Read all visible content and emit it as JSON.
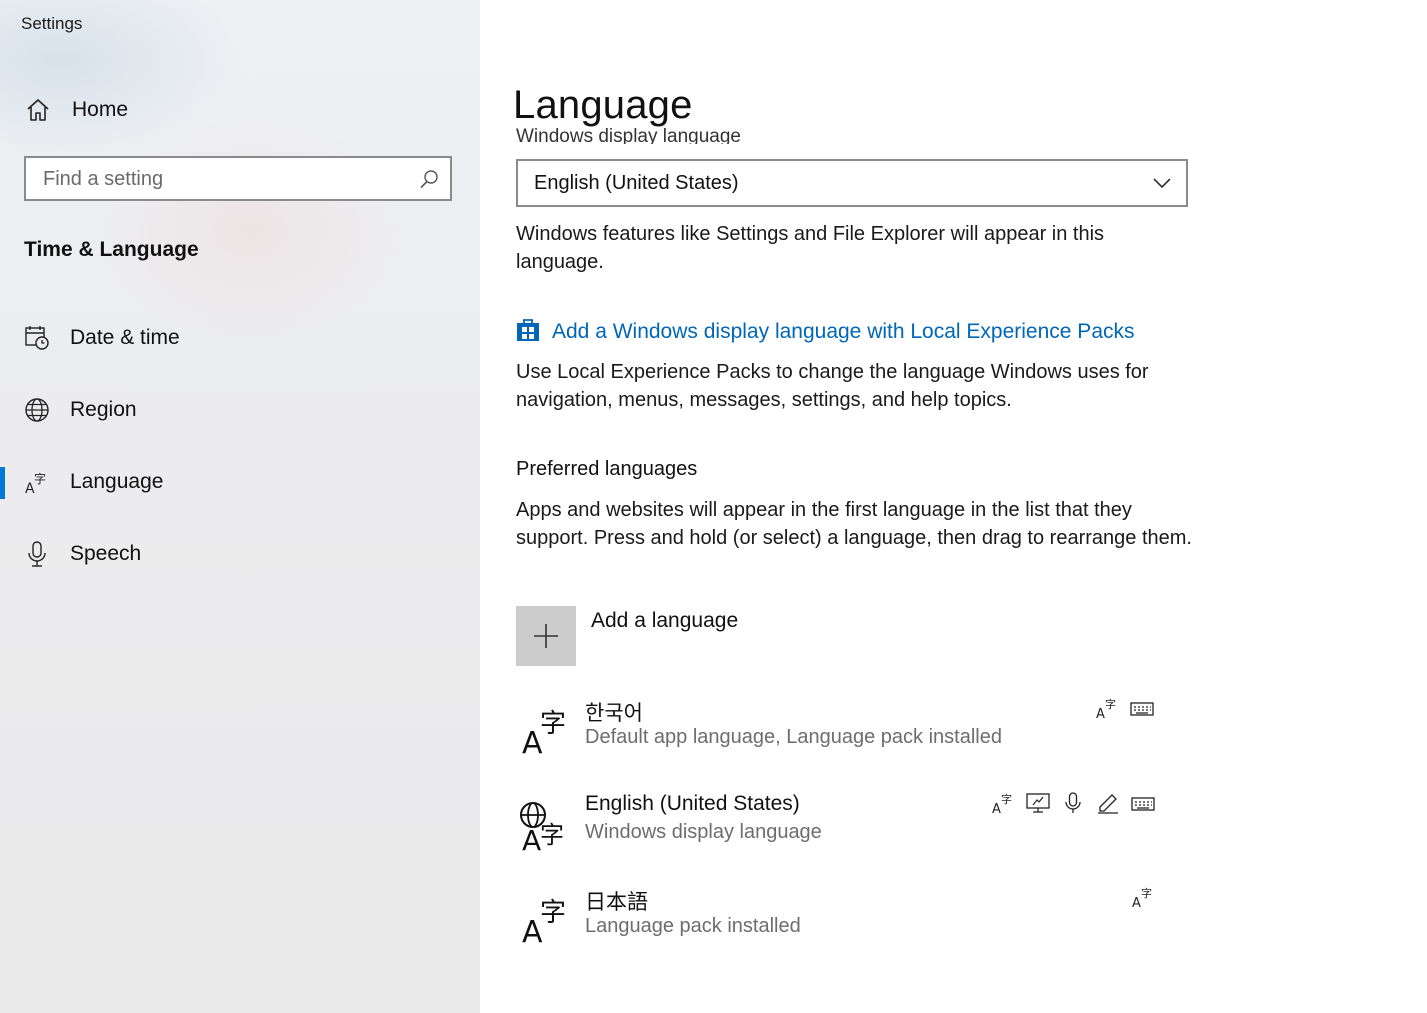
{
  "app": {
    "title": "Settings"
  },
  "sidebar": {
    "home_label": "Home",
    "search": {
      "placeholder": "Find a setting",
      "value": ""
    },
    "section_title": "Time & Language",
    "items": [
      {
        "label": "Date & time",
        "icon": "calendar-clock-icon",
        "selected": false
      },
      {
        "label": "Region",
        "icon": "globe-icon",
        "selected": false
      },
      {
        "label": "Language",
        "icon": "language-icon",
        "selected": true
      },
      {
        "label": "Speech",
        "icon": "microphone-icon",
        "selected": false
      }
    ]
  },
  "main": {
    "title": "Language",
    "clipped_heading": "Windows display language",
    "display_language": {
      "selected": "English (United States)"
    },
    "display_language_desc": "Windows features like Settings and File Explorer will appear in this language.",
    "lxp_link": "Add a Windows display language with Local Experience Packs",
    "lxp_desc": "Use Local Experience Packs to change the language Windows uses for navigation, menus, messages, settings, and help topics.",
    "preferred_heading": "Preferred languages",
    "preferred_desc": "Apps and websites will appear in the first language in the list that they support. Press and hold (or select) a language, then drag to rearrange them.",
    "add_language_label": "Add a language",
    "languages": [
      {
        "name": "한국어",
        "status": "Default app language, Language pack installed",
        "icon": "language-icon",
        "features": [
          "language-pack-icon",
          "keyboard-icon"
        ]
      },
      {
        "name": "English (United States)",
        "status": "Windows display language",
        "icon": "display-language-icon",
        "features": [
          "language-pack-icon",
          "text-to-speech-icon",
          "speech-icon",
          "handwriting-icon",
          "keyboard-icon"
        ]
      },
      {
        "name": "日本語",
        "status": "Language pack installed",
        "icon": "language-icon",
        "features": [
          "language-pack-icon"
        ]
      }
    ]
  },
  "colors": {
    "accent": "#0078d7",
    "link": "#0067b8",
    "secondary_text": "#6d6d6d"
  }
}
